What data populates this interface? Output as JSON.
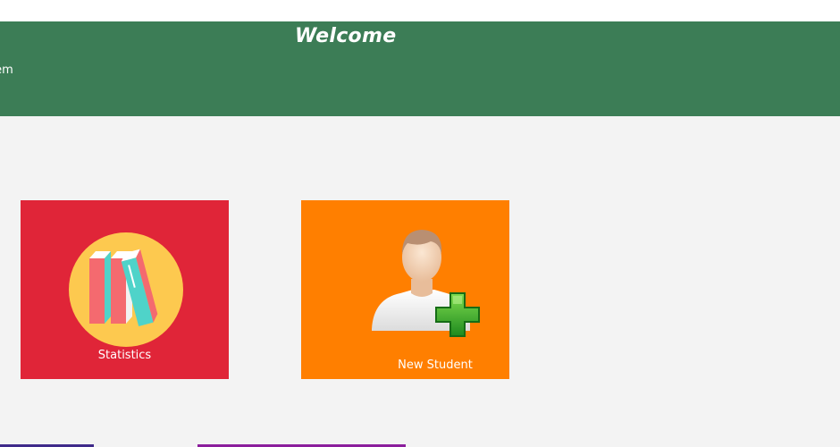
{
  "header": {
    "title": "Welcome",
    "subtitle": "tem"
  },
  "tiles": [
    {
      "label": "Statistics",
      "icon": "books-icon",
      "color": "#e02538"
    },
    {
      "label": "New Student",
      "icon": "add-user-icon",
      "color": "#ff7f00"
    }
  ],
  "colors": {
    "header": "#3c7d56",
    "background": "#f3f3f3"
  }
}
